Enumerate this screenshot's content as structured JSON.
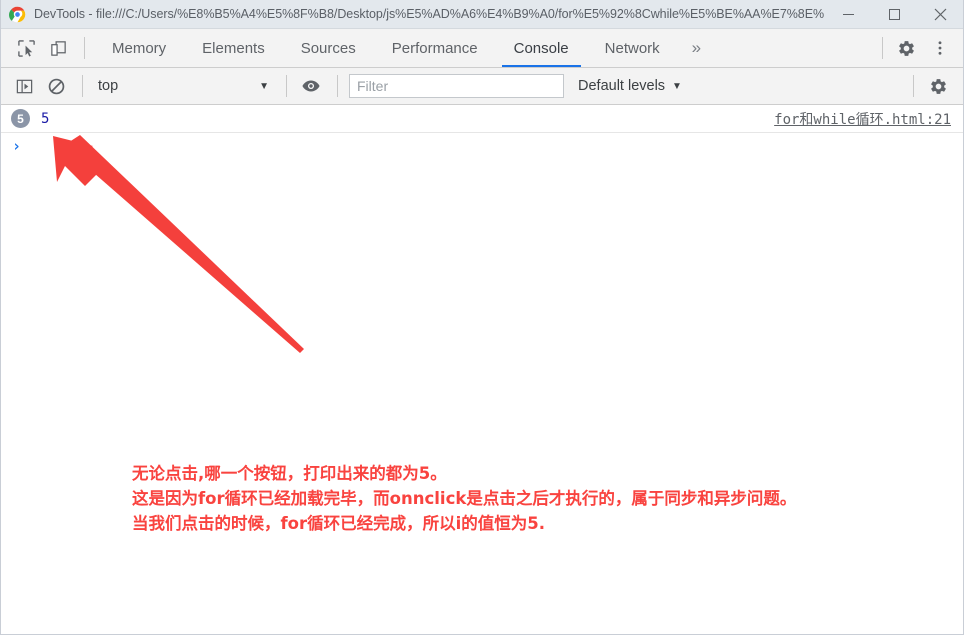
{
  "window": {
    "title": "DevTools - file:///C:/Users/%E8%B5%A4%E5%8F%B8/Desktop/js%E5%AD%A6%E4%B9%A0/for%E5%92%8Cwhile%E5%BE%AA%E7%8E%...",
    "logo": "chrome-logo",
    "controls": {
      "minimize": "minimize-icon",
      "maximize": "maximize-icon",
      "close": "close-icon"
    }
  },
  "toolbar": {
    "inspect_icon": "inspect-element-icon",
    "device_icon": "device-toolbar-icon",
    "tabs": [
      {
        "label": "Memory",
        "active": false
      },
      {
        "label": "Elements",
        "active": false
      },
      {
        "label": "Sources",
        "active": false
      },
      {
        "label": "Performance",
        "active": false
      },
      {
        "label": "Console",
        "active": true
      },
      {
        "label": "Network",
        "active": false
      }
    ],
    "more_tabs_label": "»",
    "settings_icon": "gear-icon",
    "menu_icon": "kebab-menu-icon",
    "active_tab_underline_color": "#1a73e8"
  },
  "console_toolbar": {
    "sidebar_toggle_icon": "console-sidebar-toggle-icon",
    "clear_icon": "clear-console-icon",
    "context": {
      "value": "top",
      "caret": "▼"
    },
    "eye_icon": "live-expression-eye-icon",
    "filter": {
      "placeholder": "Filter",
      "value": ""
    },
    "levels": {
      "value": "Default levels",
      "caret": "▼"
    },
    "settings_icon": "gear-icon"
  },
  "console": {
    "entries": [
      {
        "count": "5",
        "value": "5",
        "source": "for和while循环.html:21",
        "value_color": "#1a1aa6",
        "badge_color": "#8b95a7"
      }
    ],
    "prompt_caret": "›"
  },
  "annotation": {
    "color": "#f9433f",
    "arrow": "red-arrow-pointer",
    "lines": [
      "无论点击,哪一个按钮，打印出来的都为5。",
      "这是因为for循环已经加载完毕，而onnclick是点击之后才执行的，属于同步和异步问题。",
      "当我们点击的时候，for循环已经完成，所以i的值恒为5."
    ]
  }
}
